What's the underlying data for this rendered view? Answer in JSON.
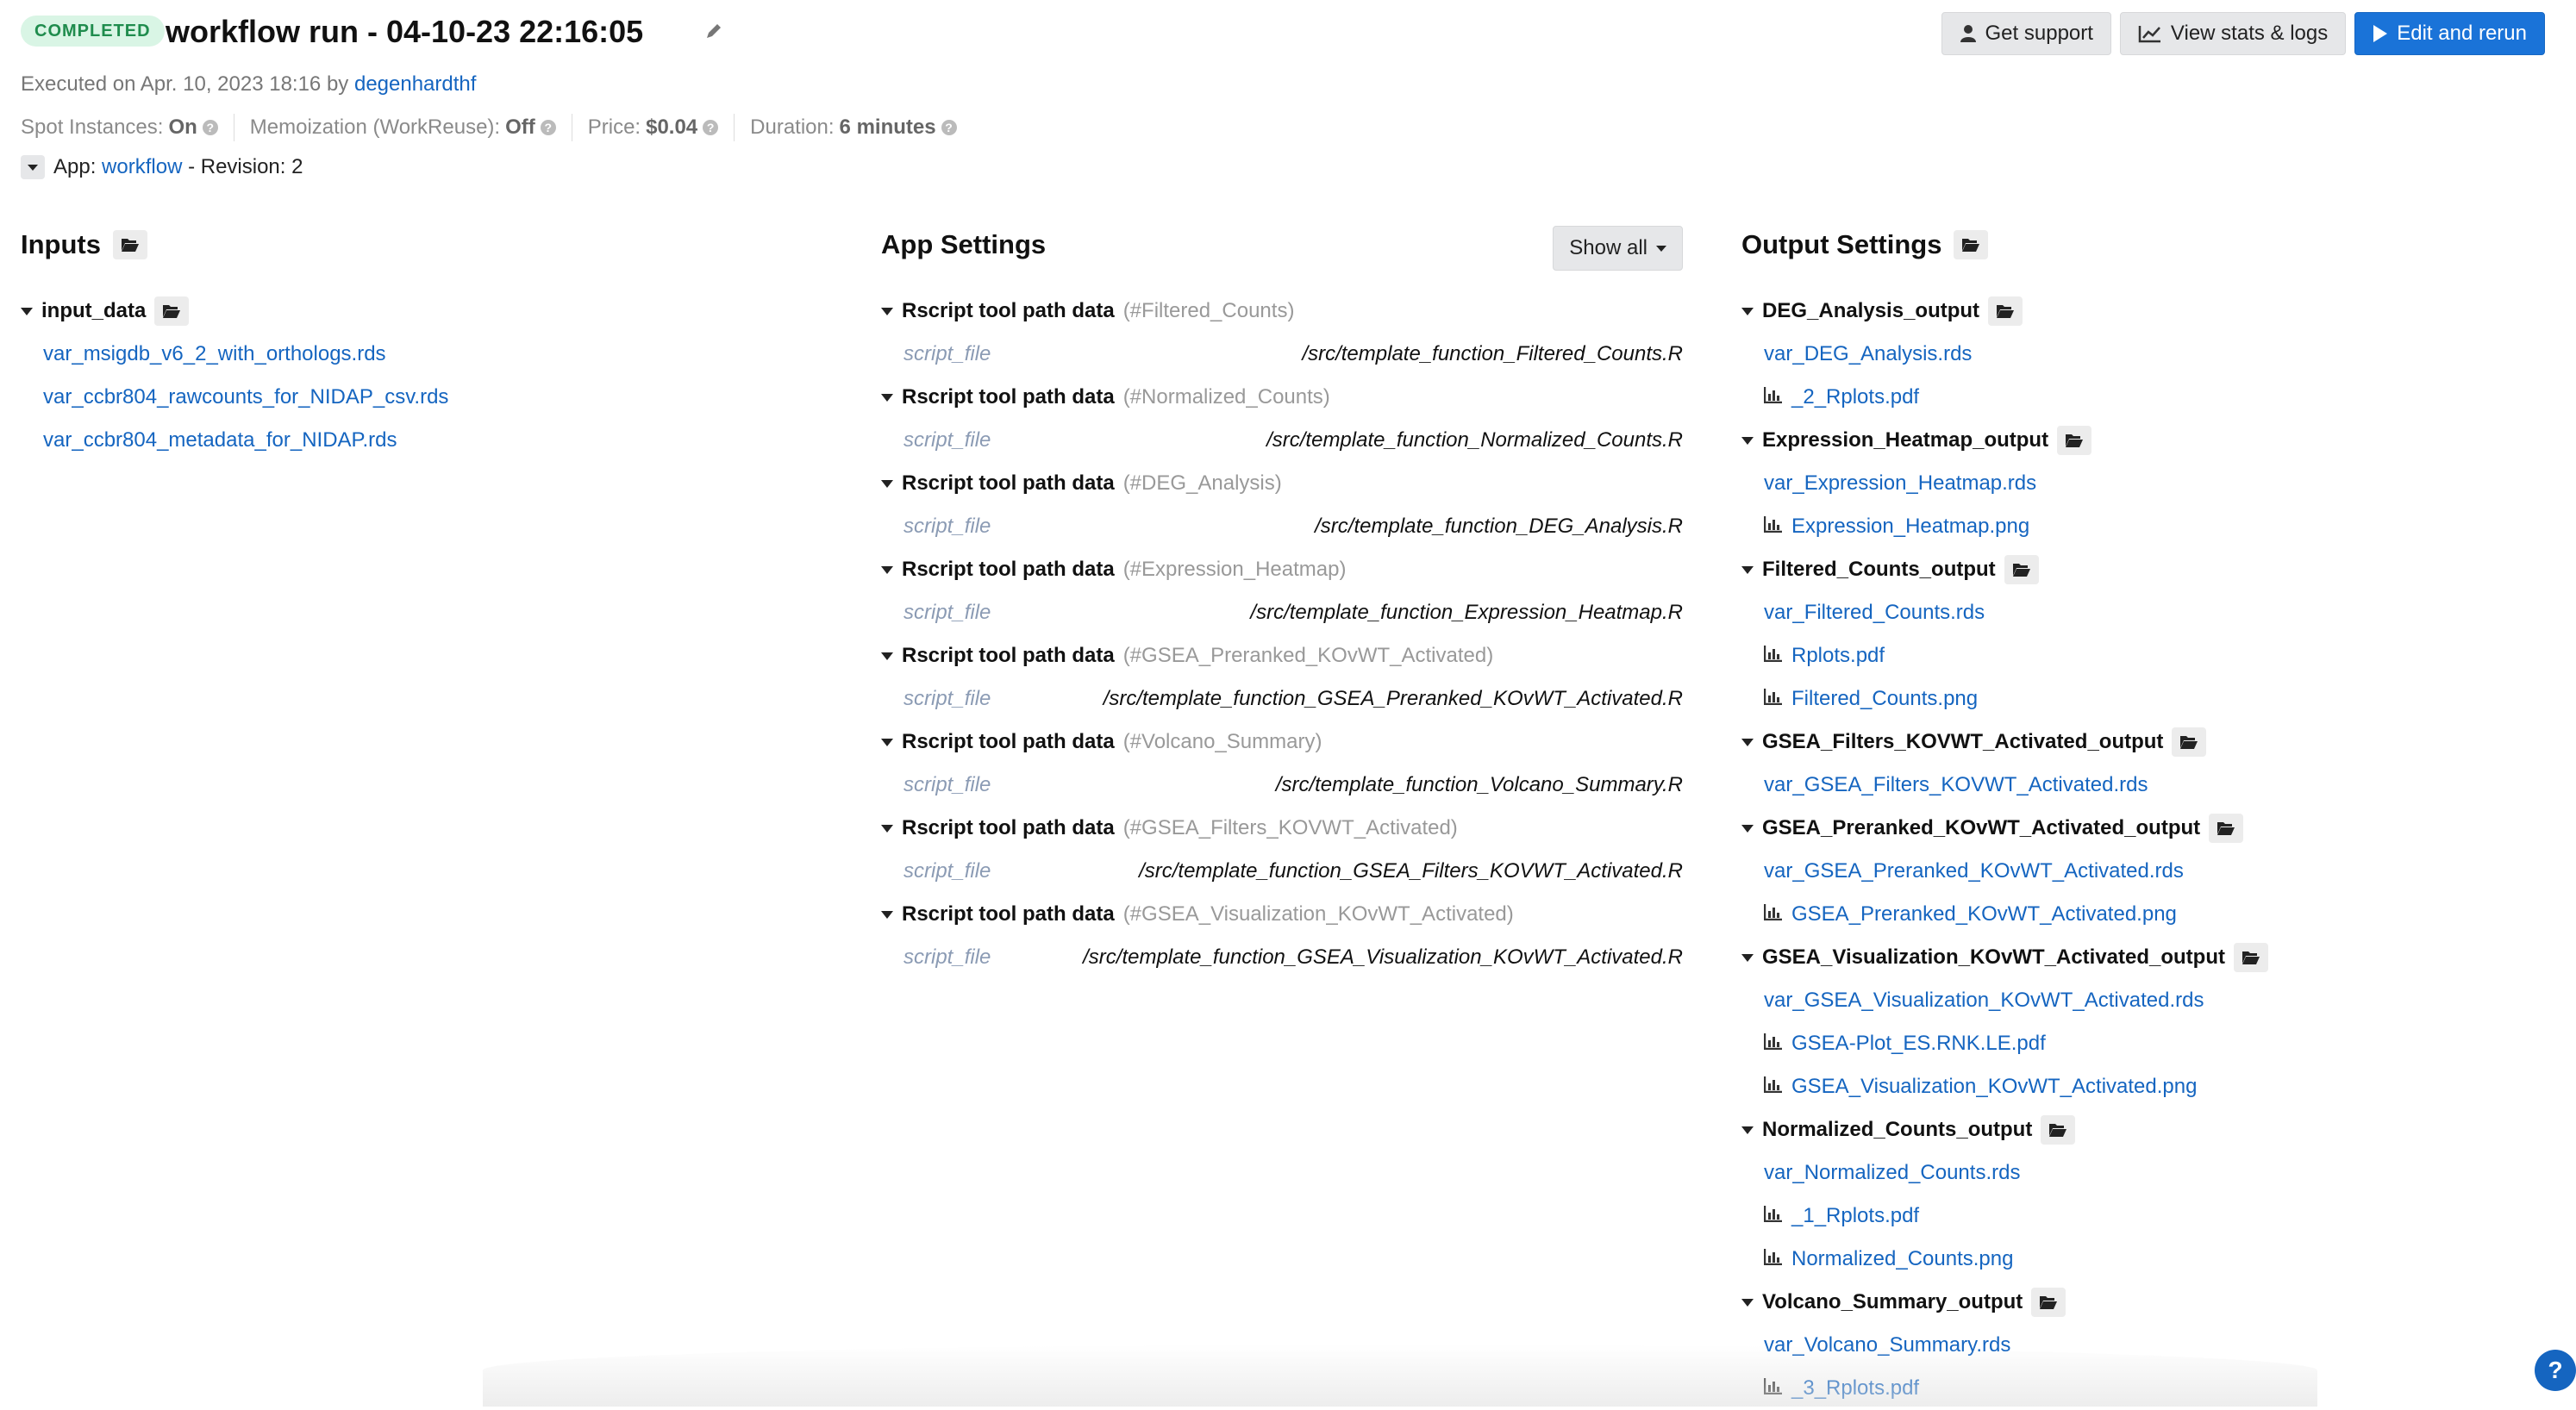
{
  "header": {
    "status": "COMPLETED",
    "title": "workflow run - 04-10-23 22:16:05",
    "buttons": {
      "support": "Get support",
      "stats": "View stats & logs",
      "rerun": "Edit and rerun"
    }
  },
  "meta": {
    "executed_prefix": "Executed on Apr. 10, 2023 18:16 by",
    "executed_user": "degenhardthf",
    "spot_label": "Spot Instances:",
    "spot_value": "On",
    "memo_label": "Memoization (WorkReuse):",
    "memo_value": "Off",
    "price_label": "Price:",
    "price_value": "$0.04",
    "duration_label": "Duration:",
    "duration_value": "6 minutes",
    "app_label": "App:",
    "app_name": "workflow",
    "revision": "- Revision: 2"
  },
  "inputs": {
    "title": "Inputs",
    "group": "input_data",
    "files": [
      "var_msigdb_v6_2_with_orthologs.rds",
      "var_ccbr804_rawcounts_for_NIDAP_csv.rds",
      "var_ccbr804_metadata_for_NIDAP.rds"
    ]
  },
  "app_settings": {
    "title": "App Settings",
    "show_all": "Show all",
    "rows": [
      {
        "head": "Rscript tool path data",
        "ref": "(#Filtered_Counts)",
        "key": "script_file",
        "value": "/src/template_function_Filtered_Counts.R"
      },
      {
        "head": "Rscript tool path data",
        "ref": "(#Normalized_Counts)",
        "key": "script_file",
        "value": "/src/template_function_Normalized_Counts.R"
      },
      {
        "head": "Rscript tool path data",
        "ref": "(#DEG_Analysis)",
        "key": "script_file",
        "value": "/src/template_function_DEG_Analysis.R"
      },
      {
        "head": "Rscript tool path data",
        "ref": "(#Expression_Heatmap)",
        "key": "script_file",
        "value": "/src/template_function_Expression_Heatmap.R"
      },
      {
        "head": "Rscript tool path data",
        "ref": "(#GSEA_Preranked_KOvWT_Activated)",
        "key": "script_file",
        "value": "/src/template_function_GSEA_Preranked_KOvWT_Activated.R"
      },
      {
        "head": "Rscript tool path data",
        "ref": "(#Volcano_Summary)",
        "key": "script_file",
        "value": "/src/template_function_Volcano_Summary.R"
      },
      {
        "head": "Rscript tool path data",
        "ref": "(#GSEA_Filters_KOVWT_Activated)",
        "key": "script_file",
        "value": "/src/template_function_GSEA_Filters_KOVWT_Activated.R"
      },
      {
        "head": "Rscript tool path data",
        "ref": "(#GSEA_Visualization_KOvWT_Activated)",
        "key": "script_file",
        "value": "/src/template_function_GSEA_Visualization_KOvWT_Activated.R"
      }
    ]
  },
  "outputs": {
    "title": "Output Settings",
    "groups": [
      {
        "name": "DEG_Analysis_output",
        "files": [
          {
            "name": "var_DEG_Analysis.rds",
            "icon": false
          },
          {
            "name": "_2_Rplots.pdf",
            "icon": true
          }
        ]
      },
      {
        "name": "Expression_Heatmap_output",
        "files": [
          {
            "name": "var_Expression_Heatmap.rds",
            "icon": false
          },
          {
            "name": "Expression_Heatmap.png",
            "icon": true
          }
        ]
      },
      {
        "name": "Filtered_Counts_output",
        "files": [
          {
            "name": "var_Filtered_Counts.rds",
            "icon": false
          },
          {
            "name": "Rplots.pdf",
            "icon": true
          },
          {
            "name": "Filtered_Counts.png",
            "icon": true
          }
        ]
      },
      {
        "name": "GSEA_Filters_KOVWT_Activated_output",
        "files": [
          {
            "name": "var_GSEA_Filters_KOVWT_Activated.rds",
            "icon": false
          }
        ]
      },
      {
        "name": "GSEA_Preranked_KOvWT_Activated_output",
        "files": [
          {
            "name": "var_GSEA_Preranked_KOvWT_Activated.rds",
            "icon": false
          },
          {
            "name": "GSEA_Preranked_KOvWT_Activated.png",
            "icon": true
          }
        ]
      },
      {
        "name": "GSEA_Visualization_KOvWT_Activated_output",
        "files": [
          {
            "name": "var_GSEA_Visualization_KOvWT_Activated.rds",
            "icon": false
          },
          {
            "name": "GSEA-Plot_ES.RNK.LE.pdf",
            "icon": true
          },
          {
            "name": "GSEA_Visualization_KOvWT_Activated.png",
            "icon": true
          }
        ]
      },
      {
        "name": "Normalized_Counts_output",
        "files": [
          {
            "name": "var_Normalized_Counts.rds",
            "icon": false
          },
          {
            "name": "_1_Rplots.pdf",
            "icon": true
          },
          {
            "name": "Normalized_Counts.png",
            "icon": true
          }
        ]
      },
      {
        "name": "Volcano_Summary_output",
        "files": [
          {
            "name": "var_Volcano_Summary.rds",
            "icon": false
          },
          {
            "name": "_3_Rplots.pdf",
            "icon": true
          }
        ]
      }
    ]
  },
  "help": "?"
}
